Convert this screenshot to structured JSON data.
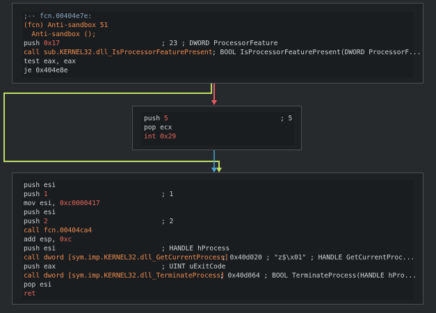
{
  "colors": {
    "background": "#272a2d",
    "node_bg": "#1e2124",
    "node_border": "#4b5055",
    "edge_true": "#bfe06a",
    "edge_false": "#e8575f",
    "edge_uncond": "#4aa3d4",
    "text": "#cfd2d4",
    "number": "#e8675c",
    "call": "#f08c4e",
    "comment": "#8aa6c2"
  },
  "block1": {
    "header": ";-- fcn.00404e7e:",
    "fcn_line": "(fcn) Anti-sandbox 51",
    "sig_line": "  Anti-sandbox ();",
    "l1_mn": "push ",
    "l1_arg": "0x17",
    "l1_cm": "; 23 ; DWORD ProcessorFeature",
    "l2_mn": "call sub.KERNEL32.dll_IsProcessorFeaturePresent",
    "l2_cm": "; BOOL IsProcessorFeaturePresent(DWORD ProcessorF...",
    "l3": "test eax, eax",
    "l4_mn": "je ",
    "l4_arg": "0x404e8e"
  },
  "block2": {
    "l1_mn": "push ",
    "l1_arg": "5",
    "l1_cm": "; 5",
    "l2": "pop ecx",
    "l3": "int 0x29"
  },
  "block3": {
    "l1": "push esi",
    "l2_mn": "push ",
    "l2_arg": "1",
    "l2_cm": "; 1",
    "l3_mn": "mov esi, ",
    "l3_arg": "0xc0000417",
    "l4": "push esi",
    "l5_mn": "push ",
    "l5_arg": "2",
    "l5_cm": "; 2",
    "l6": "call fcn.00404ca4",
    "l7_mn": "add esp, ",
    "l7_arg": "0xc",
    "l8_mn": "push esi",
    "l8_cm": "; HANDLE hProcess",
    "l9_mn": "call dword [sym.imp.KERNEL32.dll_GetCurrentProcess]",
    "l9_cm": "; 0x40d020 ; \"z$\\x01\" ; HANDLE GetCurrentProc...",
    "l10_mn": "push eax",
    "l10_cm": "; UINT uExitCode",
    "l11_mn": "call dword [sym.imp.KERNEL32.dll_TerminateProcess]",
    "l11_cm": "; 0x40d064 ; BOOL TerminateProcess(HANDLE hPro...",
    "l12": "pop esi",
    "l13": "ret"
  }
}
